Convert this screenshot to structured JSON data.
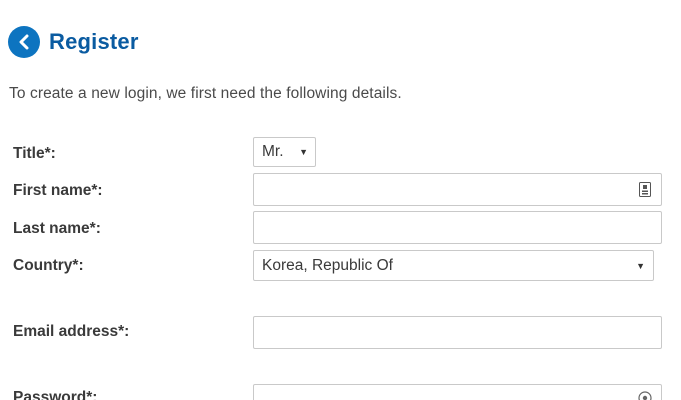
{
  "header": {
    "title": "Register",
    "back_icon": "chevron-left-icon",
    "accent_color": "#0d74c0"
  },
  "intro_text": "To create a new login, we first need the following details.",
  "form": {
    "title": {
      "label": "Title*:",
      "selected": "Mr."
    },
    "first_name": {
      "label": "First name*:",
      "value": "",
      "icon": "contact-card-icon"
    },
    "last_name": {
      "label": "Last name*:",
      "value": ""
    },
    "country": {
      "label": "Country*:",
      "selected": "Korea, Republic Of"
    },
    "email": {
      "label": "Email address*:",
      "value": ""
    },
    "password": {
      "label": "Password*:",
      "value": "",
      "icon": "reveal-password-icon"
    }
  }
}
